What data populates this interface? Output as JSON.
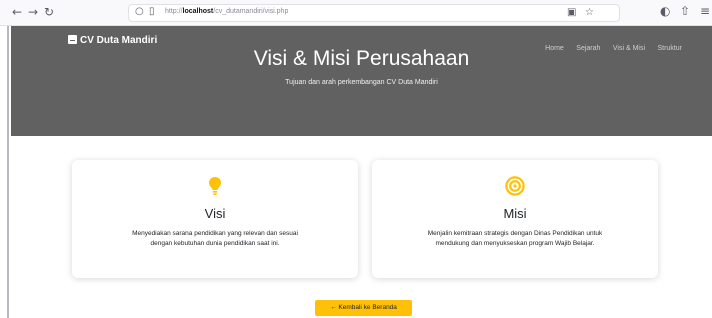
{
  "browser": {
    "url_prefix": "http://",
    "url_host": "localhost",
    "url_path": "/cv_dutamandiri/visi.php"
  },
  "navbar": {
    "brand": "CV Duta Mandiri",
    "links": [
      "Home",
      "Sejarah",
      "Visi & Misi",
      "Struktur"
    ]
  },
  "hero": {
    "title": "Visi & Misi Perusahaan",
    "subtitle": "Tujuan dan arah perkembangan CV Duta Mandiri"
  },
  "cards": [
    {
      "icon": "lightbulb-icon",
      "title": "Visi",
      "desc_lines": [
        "Menyediakan sarana pendidikan yang relevan dan sesuai",
        "dengan kebutuhan dunia pendidikan saat ini."
      ]
    },
    {
      "icon": "target-icon",
      "title": "Misi",
      "desc_lines": [
        "Menjalin kemitraan strategis dengan Dinas Pendidikan untuk",
        "mendukung dan menyukseskan program Wajib Belajar."
      ]
    }
  ],
  "back_button": {
    "arrow": "←",
    "label": "Kembali ke Beranda"
  },
  "colors": {
    "hero_bg": "#616161",
    "accent": "#ffc107"
  }
}
